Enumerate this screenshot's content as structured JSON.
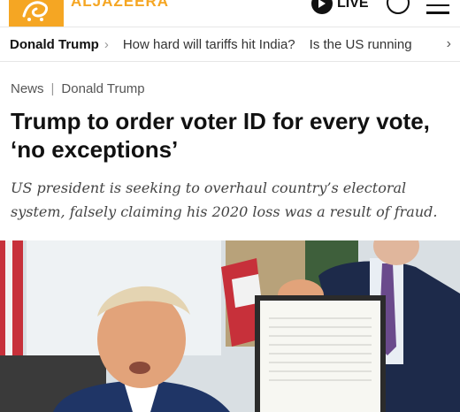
{
  "header": {
    "brand": "ALJAZEERA",
    "live_label": "LIVE",
    "icons": [
      "aljazeera-logo",
      "play-icon",
      "account-icon",
      "menu-icon"
    ]
  },
  "trending": {
    "title": "Donald Trump",
    "items": [
      "How hard will tariffs hit India?",
      "Is the US running"
    ]
  },
  "article": {
    "breadcrumb": [
      "News",
      "Donald Trump"
    ],
    "headline": "Trump to order voter ID for every vote, ‘no exceptions’",
    "standfirst": "US president is seeking to overhaul country’s electoral system, falsely claiming his 2020 loss was a result of fraud."
  },
  "colors": {
    "brand": "#f5a623",
    "text": "#111111"
  }
}
